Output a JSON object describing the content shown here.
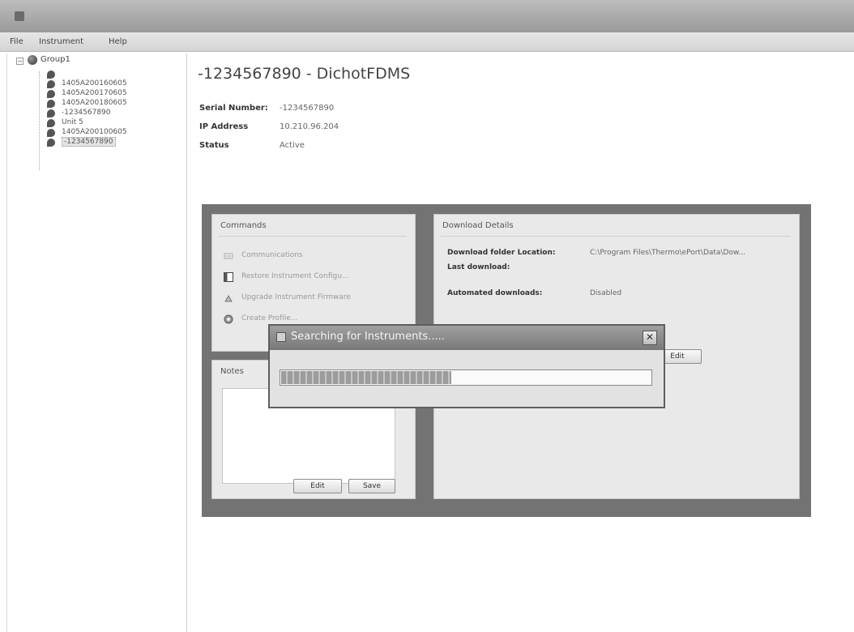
{
  "menu": {
    "file": "File",
    "instrument": "Instrument",
    "help": "Help"
  },
  "tree": {
    "group": "Group1",
    "nodes": [
      {
        "label": "",
        "selected": false
      },
      {
        "label": "1405A200160605",
        "selected": false
      },
      {
        "label": "1405A200170605",
        "selected": false
      },
      {
        "label": "1405A200180605",
        "selected": false
      },
      {
        "label": "-1234567890",
        "selected": false
      },
      {
        "label": "Unit 5",
        "selected": false
      },
      {
        "label": "1405A200100605",
        "selected": false
      },
      {
        "label": "-1234567890",
        "selected": true
      }
    ]
  },
  "device": {
    "title": "-1234567890  - DichotFDMS",
    "serial_label": "Serial Number:",
    "serial_value": "-1234567890",
    "ip_label": "IP Address",
    "ip_value": "10.210.96.204",
    "status_label": "Status",
    "status_value": "Active"
  },
  "commands": {
    "caption": "Commands",
    "items": [
      {
        "label": "Communications",
        "icon": "communications-icon"
      },
      {
        "label": "Restore Instrument Configu...",
        "icon": "restore-icon"
      },
      {
        "label": "Upgrade Instrument Firmware",
        "icon": "upgrade-icon"
      },
      {
        "label": "Create Profile...",
        "icon": "profile-icon"
      }
    ]
  },
  "notes": {
    "caption": "Notes",
    "edit_label": "Edit",
    "save_label": "Save"
  },
  "download": {
    "caption": "Download Details",
    "folder_label": "Download folder Location:",
    "folder_value": "C:\\Program Files\\Thermo\\ePort\\Data\\Dow...",
    "last_label": "Last download:",
    "last_value": "",
    "auto_label": "Automated downloads:",
    "auto_value": "Disabled",
    "edit_label": "Edit"
  },
  "dialog": {
    "title": "Searching for Instruments.....",
    "close_label": "✕",
    "progress": 0.46
  }
}
